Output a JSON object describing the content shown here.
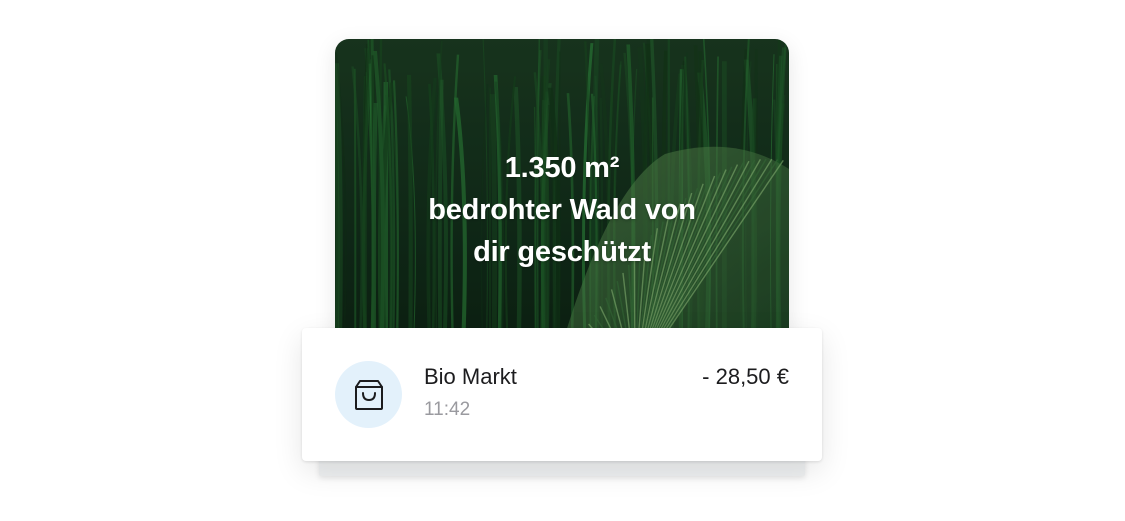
{
  "impact_card": {
    "line1": "1.350 m²",
    "line2": "bedrohter Wald von",
    "line3": "dir geschützt"
  },
  "transaction": {
    "icon": "shopping-bag-icon",
    "merchant": "Bio Markt",
    "time": "11:42",
    "amount": "- 28,50 €"
  },
  "colors": {
    "forest_dark": "#0f2a18",
    "forest_green": "#2f6b3a",
    "icon_circle": "#e3f1fb",
    "time_text": "#9a9a9f"
  }
}
